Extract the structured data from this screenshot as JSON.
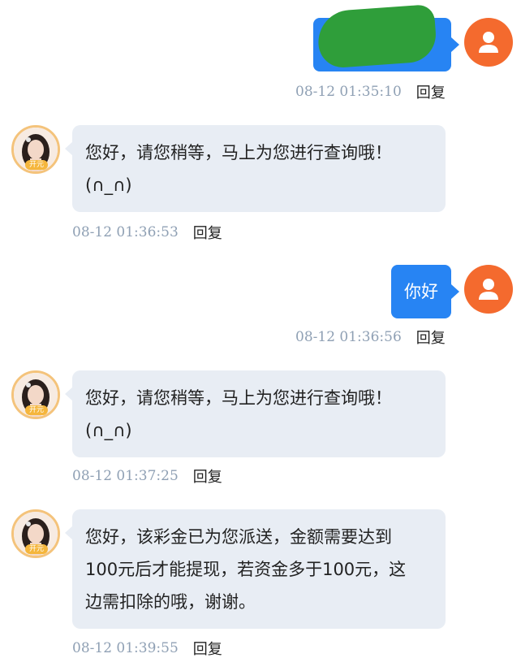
{
  "reply_label": "回复",
  "messages": [
    {
      "side": "user",
      "text": "",
      "time": "08-12 01:35:10"
    },
    {
      "side": "agent",
      "badge": "开元",
      "lines": [
        "您好，请您稍等，马上为您进行查询哦！",
        "(∩_∩)"
      ],
      "time": "08-12 01:36:53"
    },
    {
      "side": "user",
      "text": "你好",
      "time": "08-12 01:36:56"
    },
    {
      "side": "agent",
      "badge": "开元",
      "lines": [
        "您好，请您稍等，马上为您进行查询哦！",
        "(∩_∩)"
      ],
      "time": "08-12 01:37:25"
    },
    {
      "side": "agent",
      "badge": "开元",
      "lines": [
        "您好，该彩金已为您派送，金额需要达到",
        "100元后才能提现，若资金多于100元，这",
        "边需扣除的哦，谢谢。"
      ],
      "time": "08-12 01:39:55"
    }
  ],
  "colors": {
    "user_bubble": "#2784f3",
    "agent_bubble": "#e8edf4",
    "user_avatar": "#f46a2e",
    "agent_avatar_ring": "#f4c37b",
    "redaction": "#2f9e3a"
  },
  "icons": {
    "user_avatar": "user-icon",
    "agent_avatar": "agent-portrait-icon"
  }
}
